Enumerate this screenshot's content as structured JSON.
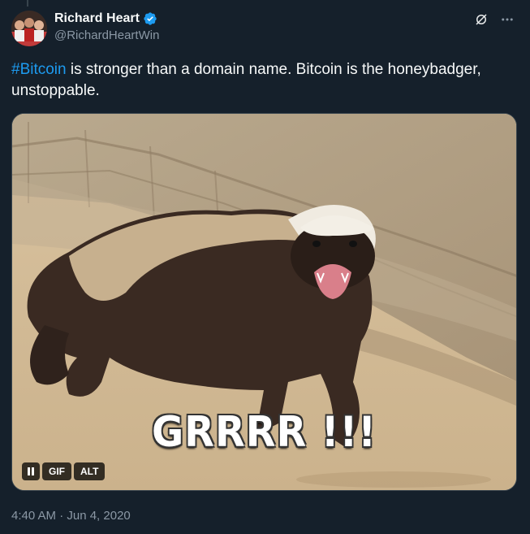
{
  "author": {
    "display_name": "Richard Heart",
    "handle": "@RichardHeartWin",
    "verified": true,
    "avatar_icon": "profile-photo"
  },
  "tweet": {
    "hashtag": "#Bitcoin",
    "text_after_hashtag": " is stronger than a domain name. Bitcoin is the honeybadger, unstoppable."
  },
  "media": {
    "type": "gif",
    "caption": "GRRRR !!!",
    "controls": {
      "pause_icon": "pause-icon",
      "gif_label": "GIF",
      "alt_label": "ALT"
    }
  },
  "meta": {
    "timestamp": "4:40 AM · Jun 4, 2020"
  },
  "colors": {
    "background": "#15202b",
    "link": "#1d9bf0",
    "muted": "#8b98a5",
    "verified": "#1d9bf0"
  }
}
